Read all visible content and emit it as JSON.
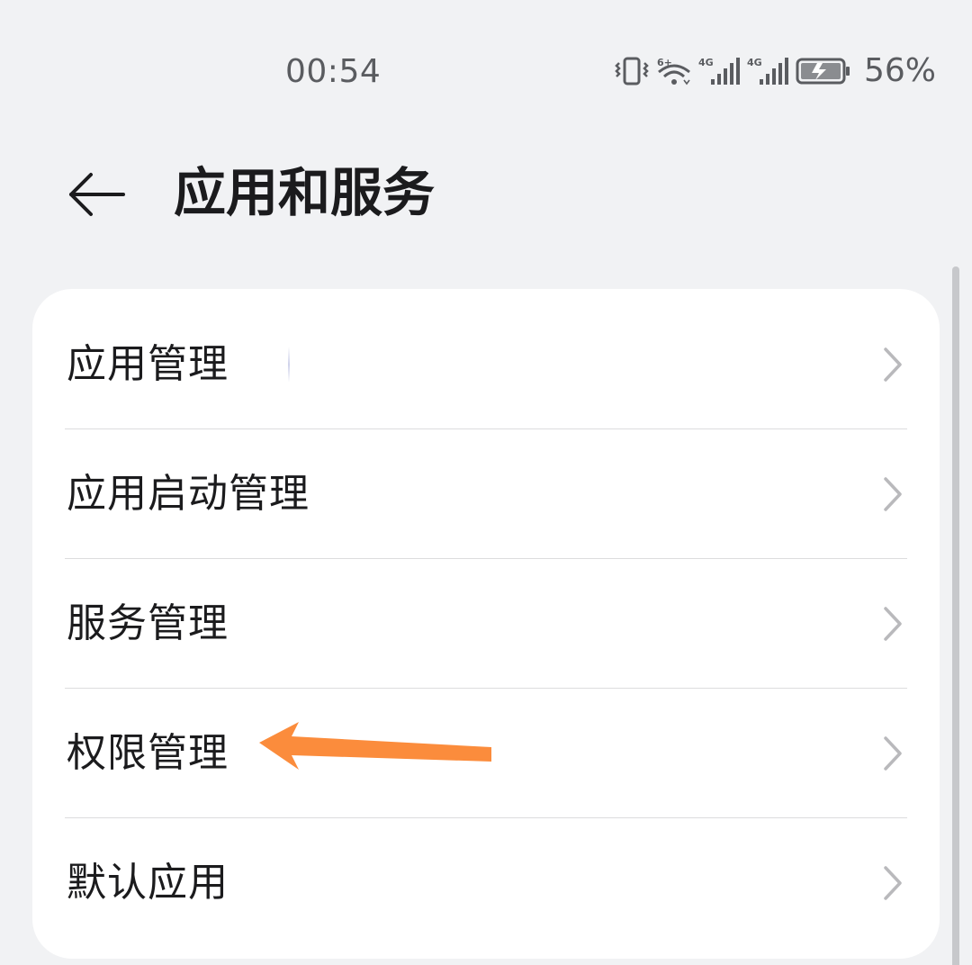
{
  "status_bar": {
    "time": "00:54",
    "battery_percent": "56%",
    "icons": [
      "vibrate-icon",
      "wifi-6-icon",
      "signal-4g-icon",
      "signal-4g-icon",
      "battery-charging-icon"
    ]
  },
  "header": {
    "back_icon": "arrow-left-icon",
    "title": "应用和服务"
  },
  "menu": {
    "items": [
      {
        "label": "应用管理"
      },
      {
        "label": "应用启动管理"
      },
      {
        "label": "服务管理"
      },
      {
        "label": "权限管理"
      },
      {
        "label": "默认应用"
      }
    ]
  },
  "annotation": {
    "type": "arrow",
    "color": "#fb8c3c",
    "points_to": "权限管理"
  },
  "colors": {
    "background": "#f1f2f4",
    "card": "#ffffff",
    "text": "#1b1b1d",
    "chevron": "#b9b9bc"
  }
}
